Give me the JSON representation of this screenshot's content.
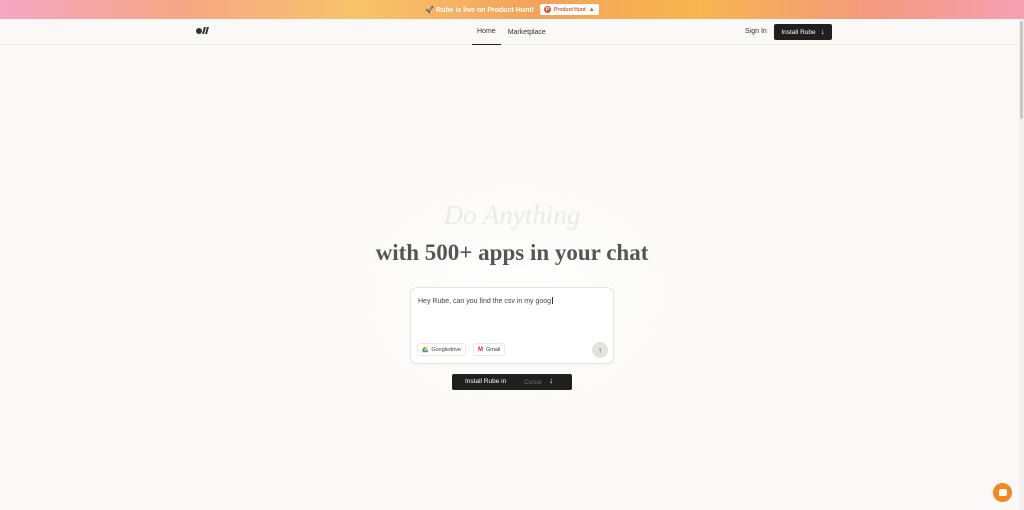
{
  "banner": {
    "text": "🚀 Rube is live on Product Hunt!",
    "badge_label": "Product Hunt",
    "colors": {
      "badge": "#da552f"
    }
  },
  "nav": {
    "tabs": [
      {
        "label": "Home",
        "active": true
      },
      {
        "label": "Marketplace",
        "active": false
      }
    ],
    "sign_in": "Sign In",
    "install_button": "Install Rube"
  },
  "hero": {
    "faded_line": "Do Anything",
    "title": "with 500+ apps in your chat"
  },
  "chat": {
    "input_value": "Hey Rube, can you find the csv in my goog",
    "chips": [
      {
        "label": "Googledrive",
        "icon": "google-drive-icon"
      },
      {
        "label": "Gmail",
        "icon": "gmail-icon"
      }
    ],
    "send_icon": "arrow-up-icon"
  },
  "cta": {
    "label": "Install Rube in",
    "target": "Cursor",
    "icon": "arrow-down-icon"
  },
  "launcher": {
    "icon": "chat-bubble-icon",
    "color": "#f7861f"
  }
}
